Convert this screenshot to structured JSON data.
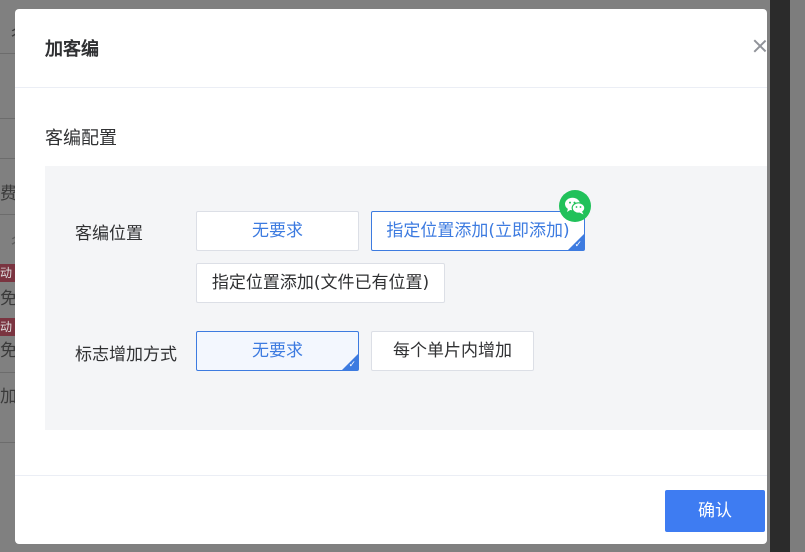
{
  "background": {
    "row_fragments": [
      "彳",
      "费",
      "彳",
      "免",
      "免",
      "加(",
      "动",
      "动"
    ]
  },
  "dialog": {
    "title": "加客编",
    "section_title": "客编配置",
    "position_row": {
      "label": "客编位置",
      "options": [
        {
          "label": "无要求",
          "selected": false
        },
        {
          "label": "指定位置添加(立即添加)",
          "selected": true
        },
        {
          "label": "指定位置添加(文件已有位置)",
          "selected": false
        }
      ]
    },
    "mark_row": {
      "label": "标志增加方式",
      "options": [
        {
          "label": "无要求",
          "selected": true
        },
        {
          "label": "每个单片内增加",
          "selected": false
        }
      ]
    },
    "confirm_label": "确认",
    "badge_icon": "wechat-icon",
    "colors": {
      "accent": "#3e7cf2",
      "badge": "#21c15a"
    }
  }
}
